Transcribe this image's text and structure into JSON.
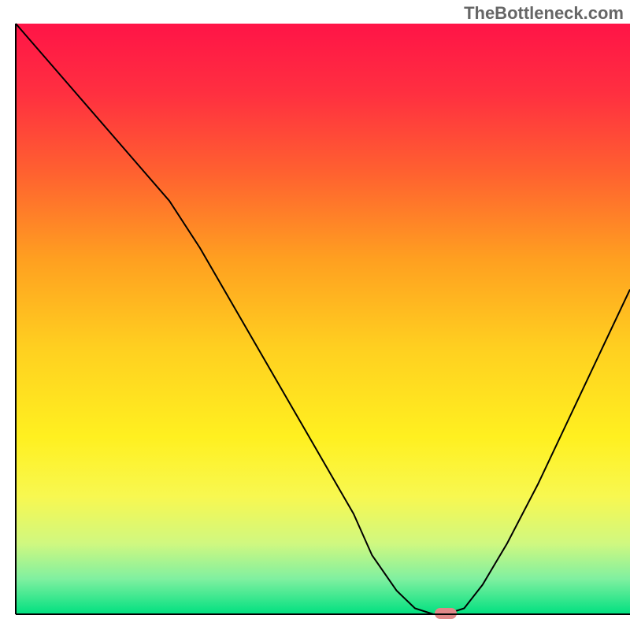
{
  "watermark": "TheBottleneck.com",
  "chart_data": {
    "type": "line",
    "title": "",
    "xlabel": "",
    "ylabel": "",
    "xlim": [
      0,
      100
    ],
    "ylim": [
      0,
      100
    ],
    "background": {
      "type": "vertical-gradient",
      "stops": [
        {
          "offset": 0,
          "color": "#ff1447"
        },
        {
          "offset": 12,
          "color": "#ff3040"
        },
        {
          "offset": 25,
          "color": "#ff6030"
        },
        {
          "offset": 40,
          "color": "#ffa020"
        },
        {
          "offset": 55,
          "color": "#ffd020"
        },
        {
          "offset": 70,
          "color": "#fff020"
        },
        {
          "offset": 80,
          "color": "#f8f850"
        },
        {
          "offset": 88,
          "color": "#d0f880"
        },
        {
          "offset": 94,
          "color": "#80f0a0"
        },
        {
          "offset": 100,
          "color": "#00e080"
        }
      ]
    },
    "border": {
      "left": true,
      "bottom": true,
      "right": false,
      "top": false
    },
    "series": [
      {
        "name": "bottleneck-curve",
        "color": "#000000",
        "width": 2,
        "x": [
          0,
          5,
          10,
          15,
          20,
          25,
          30,
          35,
          40,
          45,
          50,
          55,
          58,
          62,
          65,
          68,
          70,
          73,
          76,
          80,
          85,
          90,
          95,
          100
        ],
        "y": [
          100,
          94,
          88,
          82,
          76,
          70,
          62,
          53,
          44,
          35,
          26,
          17,
          10,
          4,
          1,
          0,
          0,
          1,
          5,
          12,
          22,
          33,
          44,
          55
        ]
      }
    ],
    "marker": {
      "name": "optimal-point",
      "x": 70,
      "y": 0,
      "color": "#e08888",
      "shape": "rounded-pill"
    }
  }
}
